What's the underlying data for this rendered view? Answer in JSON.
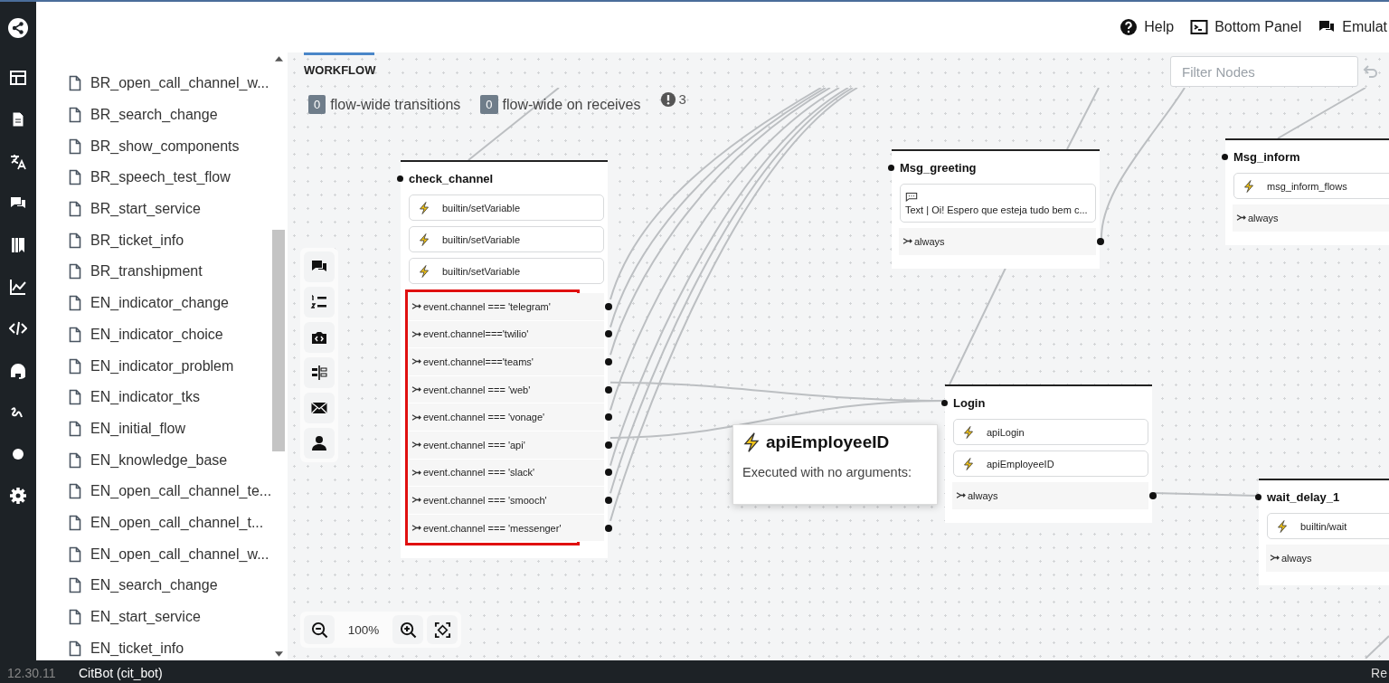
{
  "header": {
    "actions": [
      {
        "kind": "help",
        "label": "Help"
      },
      {
        "kind": "panel",
        "label": "Bottom Panel"
      },
      {
        "kind": "emulator",
        "label": "Emulat"
      }
    ]
  },
  "sidebar": {
    "files": [
      "BR_open_call_channel_w...",
      "BR_search_change",
      "BR_show_components",
      "BR_speech_test_flow",
      "BR_start_service",
      "BR_ticket_info",
      "BR_transhipment",
      "EN_indicator_change",
      "EN_indicator_choice",
      "EN_indicator_problem",
      "EN_indicator_tks",
      "EN_initial_flow",
      "EN_knowledge_base",
      "EN_open_call_channel_te...",
      "EN_open_call_channel_t...",
      "EN_open_call_channel_w...",
      "EN_search_change",
      "EN_start_service",
      "EN_ticket_info"
    ]
  },
  "workflow": {
    "tabs": [
      {
        "label": "WORKFLOW",
        "selected": true
      }
    ],
    "filter": {
      "placeholder": "Filter Nodes"
    },
    "counters": [
      {
        "count": "0",
        "label": "flow-wide transitions"
      },
      {
        "count": "0",
        "label": "flow-wide on receives"
      }
    ],
    "warnings": "3",
    "nodes": [
      {
        "title": "check_channel",
        "highlight_transitions": true,
        "items": [
          {
            "kind": "action",
            "text": "builtin/setVariable"
          },
          {
            "kind": "action",
            "text": "builtin/setVariable"
          },
          {
            "kind": "action",
            "text": "builtin/setVariable"
          },
          {
            "kind": "transition",
            "text": "event.channel === 'telegram'"
          },
          {
            "kind": "transition",
            "text": "event.channel==='twilio'"
          },
          {
            "kind": "transition",
            "text": "event.channel==='teams'"
          },
          {
            "kind": "transition",
            "text": "event.channel === 'web'"
          },
          {
            "kind": "transition",
            "text": "event.channel === 'vonage'"
          },
          {
            "kind": "transition",
            "text": "event.channel === 'api'"
          },
          {
            "kind": "transition",
            "text": "event.channel === 'slack'"
          },
          {
            "kind": "transition",
            "text": "event.channel === 'smooch'"
          },
          {
            "kind": "transition",
            "text": "event.channel === 'messenger'"
          }
        ]
      },
      {
        "title": "Msg_greeting",
        "highlight_transitions": false,
        "items": [
          {
            "kind": "message",
            "text": "Text | Oi! Espero que esteja tudo bem c..."
          },
          {
            "kind": "transition",
            "text": "always"
          }
        ]
      },
      {
        "title": "Msg_inform",
        "highlight_transitions": false,
        "items": [
          {
            "kind": "action",
            "text": "msg_inform_flows"
          },
          {
            "kind": "transition",
            "text": "always"
          }
        ]
      },
      {
        "title": "Login",
        "highlight_transitions": false,
        "items": [
          {
            "kind": "action",
            "text": "apiLogin"
          },
          {
            "kind": "action",
            "text": "apiEmployeeID"
          },
          {
            "kind": "transition",
            "text": "always"
          }
        ]
      },
      {
        "title": "wait_delay_1",
        "highlight_transitions": false,
        "items": [
          {
            "kind": "action",
            "text": "builtin/wait"
          },
          {
            "kind": "transition",
            "text": "always"
          }
        ]
      }
    ],
    "tooltip": {
      "title": "apiEmployeeID",
      "text": "Executed with no arguments:"
    },
    "zoom": "100%"
  },
  "status_bar": {
    "version": "12.30.11",
    "bot": "CitBot (cit_bot)",
    "right": "Re"
  }
}
